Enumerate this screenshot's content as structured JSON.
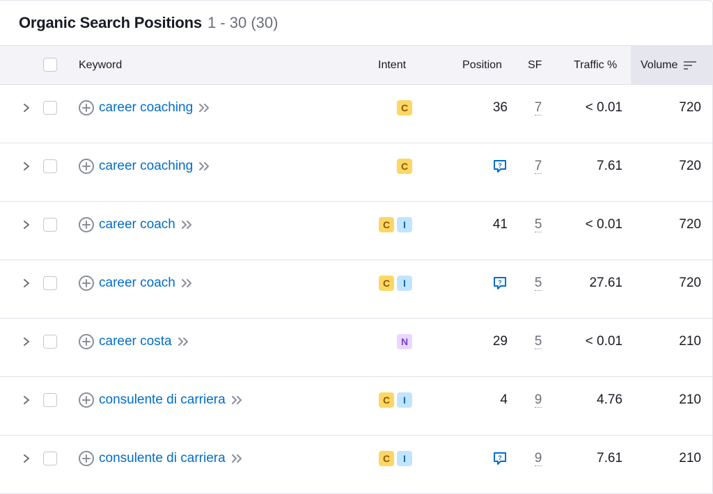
{
  "title": "Organic Search Positions",
  "range": "1 - 30 (30)",
  "columns": {
    "keyword": "Keyword",
    "intent": "Intent",
    "position": "Position",
    "sf": "SF",
    "traffic": "Traffic %",
    "volume": "Volume"
  },
  "colors": {
    "link": "#006dca",
    "header_bg": "#f4f4f8",
    "sorted_header_bg": "#e6e7ee",
    "intent_commercial": "#fcd765",
    "intent_informational": "#c2e4fc",
    "intent_navigational": "#e9d8fd"
  },
  "rows": [
    {
      "keyword": "career coaching",
      "intents": [
        "C"
      ],
      "position": "36",
      "position_icon": null,
      "sf": "7",
      "traffic": "< 0.01",
      "volume": "720"
    },
    {
      "keyword": "career coaching",
      "intents": [
        "C"
      ],
      "position": null,
      "position_icon": "faq-icon",
      "sf": "7",
      "traffic": "7.61",
      "volume": "720"
    },
    {
      "keyword": "career coach",
      "intents": [
        "C",
        "I"
      ],
      "position": "41",
      "position_icon": null,
      "sf": "5",
      "traffic": "< 0.01",
      "volume": "720"
    },
    {
      "keyword": "career coach",
      "intents": [
        "C",
        "I"
      ],
      "position": null,
      "position_icon": "faq-icon",
      "sf": "5",
      "traffic": "27.61",
      "volume": "720"
    },
    {
      "keyword": "career costa",
      "intents": [
        "N"
      ],
      "position": "29",
      "position_icon": null,
      "sf": "5",
      "traffic": "< 0.01",
      "volume": "210"
    },
    {
      "keyword": "consulente di carriera",
      "intents": [
        "C",
        "I"
      ],
      "position": "4",
      "position_icon": null,
      "sf": "9",
      "traffic": "4.76",
      "volume": "210"
    },
    {
      "keyword": "consulente di carriera",
      "intents": [
        "C",
        "I"
      ],
      "position": null,
      "position_icon": "faq-icon",
      "sf": "9",
      "traffic": "7.61",
      "volume": "210"
    }
  ]
}
